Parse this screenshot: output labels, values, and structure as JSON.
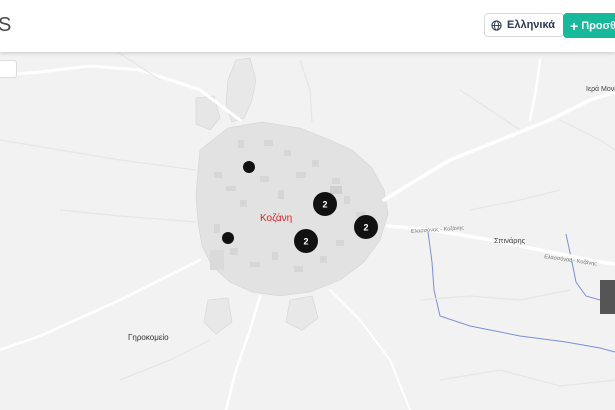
{
  "header": {
    "brand_fragment": "S",
    "language_label": "Ελληνικά",
    "language_icon": "globe-icon",
    "add_label": "Προσθήκη",
    "add_icon": "plus-icon",
    "add_color": "#16b99a"
  },
  "map": {
    "city_label": "Κοζάνη",
    "city_label_color": "#e02020",
    "place_labels": [
      {
        "name": "Γηροκομείο"
      },
      {
        "name": "Σπινάρης"
      },
      {
        "name": "Ιερά Μονή Αναλήψεως"
      }
    ],
    "road_labels": [
      {
        "name": "Ελασσόνας - Κοζάνης"
      },
      {
        "name": "Ελασσόνας - Κοζάνης"
      }
    ],
    "clusters": [
      {
        "count": "2"
      },
      {
        "count": "2"
      },
      {
        "count": "2"
      }
    ],
    "single_markers_count": 2,
    "marker_color": "#111111",
    "water_color": "#7b8fd6"
  }
}
